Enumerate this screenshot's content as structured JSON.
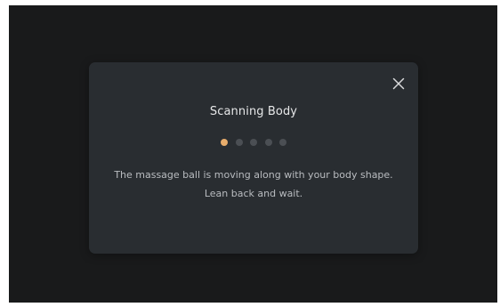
{
  "dialog": {
    "title": "Scanning Body",
    "close_icon": "close-icon",
    "message_line1": "The massage ball is moving along with your body shape.",
    "message_line2": "Lean back and wait.",
    "progress": {
      "total_steps": 5,
      "current_step": 1
    }
  },
  "colors": {
    "screen_background": "#191a1b",
    "dialog_background": "#292d31",
    "accent": "#e8ad6c",
    "inactive_dot": "#4b4f54",
    "title_text": "#e6e7e8",
    "body_text": "#b9bcc0"
  }
}
